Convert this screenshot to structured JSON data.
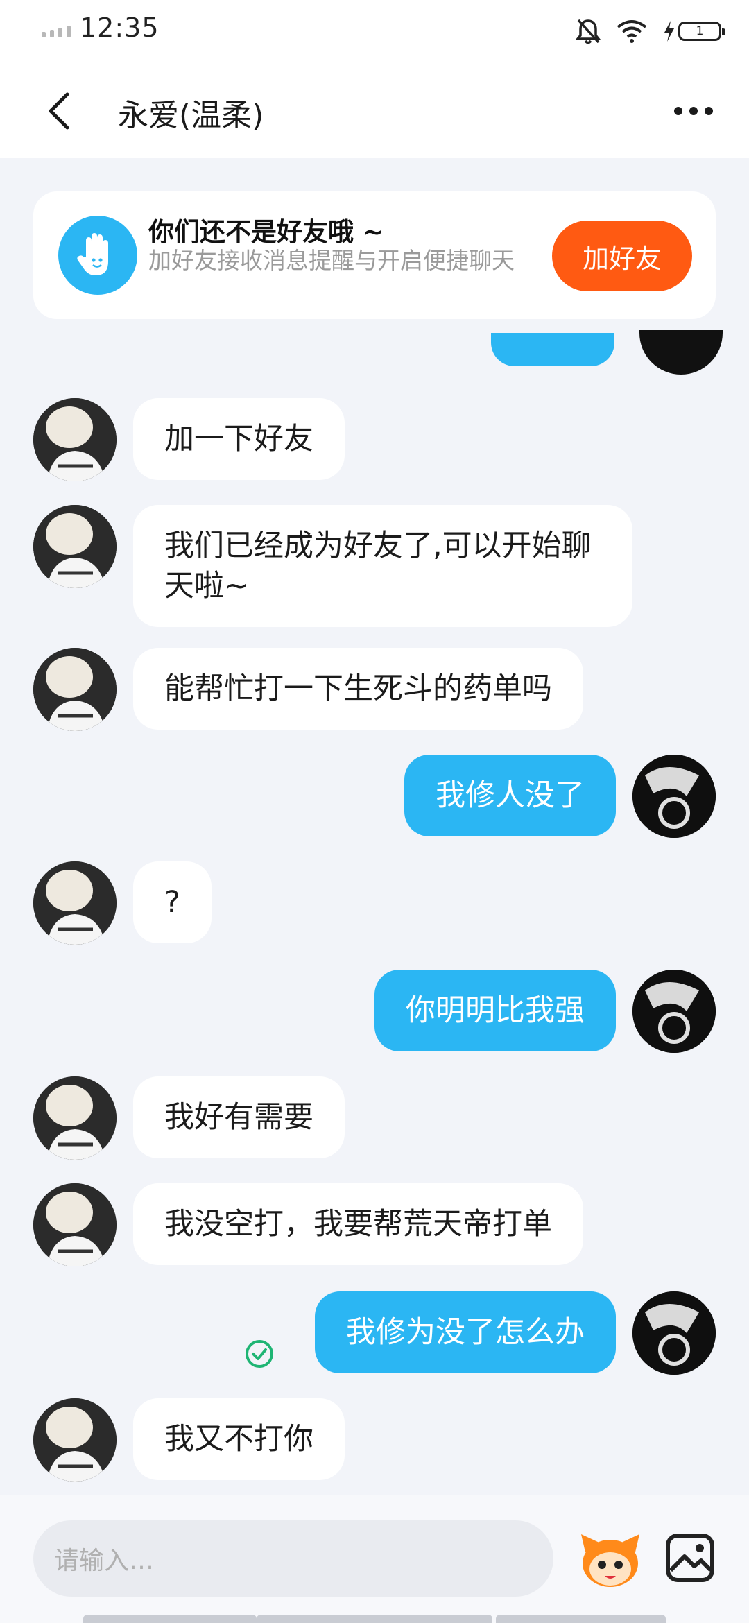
{
  "status_bar": {
    "time": "12:35",
    "battery_level": "1"
  },
  "header": {
    "title": "永爱(温柔)"
  },
  "friend_banner": {
    "title": "你们还不是好友哦 ~",
    "description": "加好友接收消息提醒与开启便捷聊天",
    "button": "加好友"
  },
  "messages": [
    {
      "side": "incoming",
      "text": "加一下好友"
    },
    {
      "side": "incoming",
      "text": "我们已经成为好友了,可以开始聊天啦~"
    },
    {
      "side": "incoming",
      "text": "能帮忙打一下生死斗的药单吗"
    },
    {
      "side": "outgoing",
      "text": "我修人没了"
    },
    {
      "side": "incoming",
      "text": "?"
    },
    {
      "side": "outgoing",
      "text": "你明明比我强"
    },
    {
      "side": "incoming",
      "text": "我好有需要"
    },
    {
      "side": "incoming",
      "text": "我没空打，我要帮荒天帝打单"
    },
    {
      "side": "outgoing",
      "text": "我修为没了怎么办",
      "status": "sent"
    },
    {
      "side": "incoming",
      "text": "我又不打你"
    }
  ],
  "input": {
    "placeholder": "请输入…"
  },
  "colors": {
    "accent_blue": "#2bb6f3",
    "add_button": "#ff5a12",
    "background": "#f2f4f9"
  },
  "icons": [
    "back-icon",
    "more-icon",
    "wave-hand-icon",
    "emoji-icon",
    "image-icon",
    "sent-check-icon",
    "mute-bell-icon",
    "wifi-icon",
    "charging-icon"
  ]
}
